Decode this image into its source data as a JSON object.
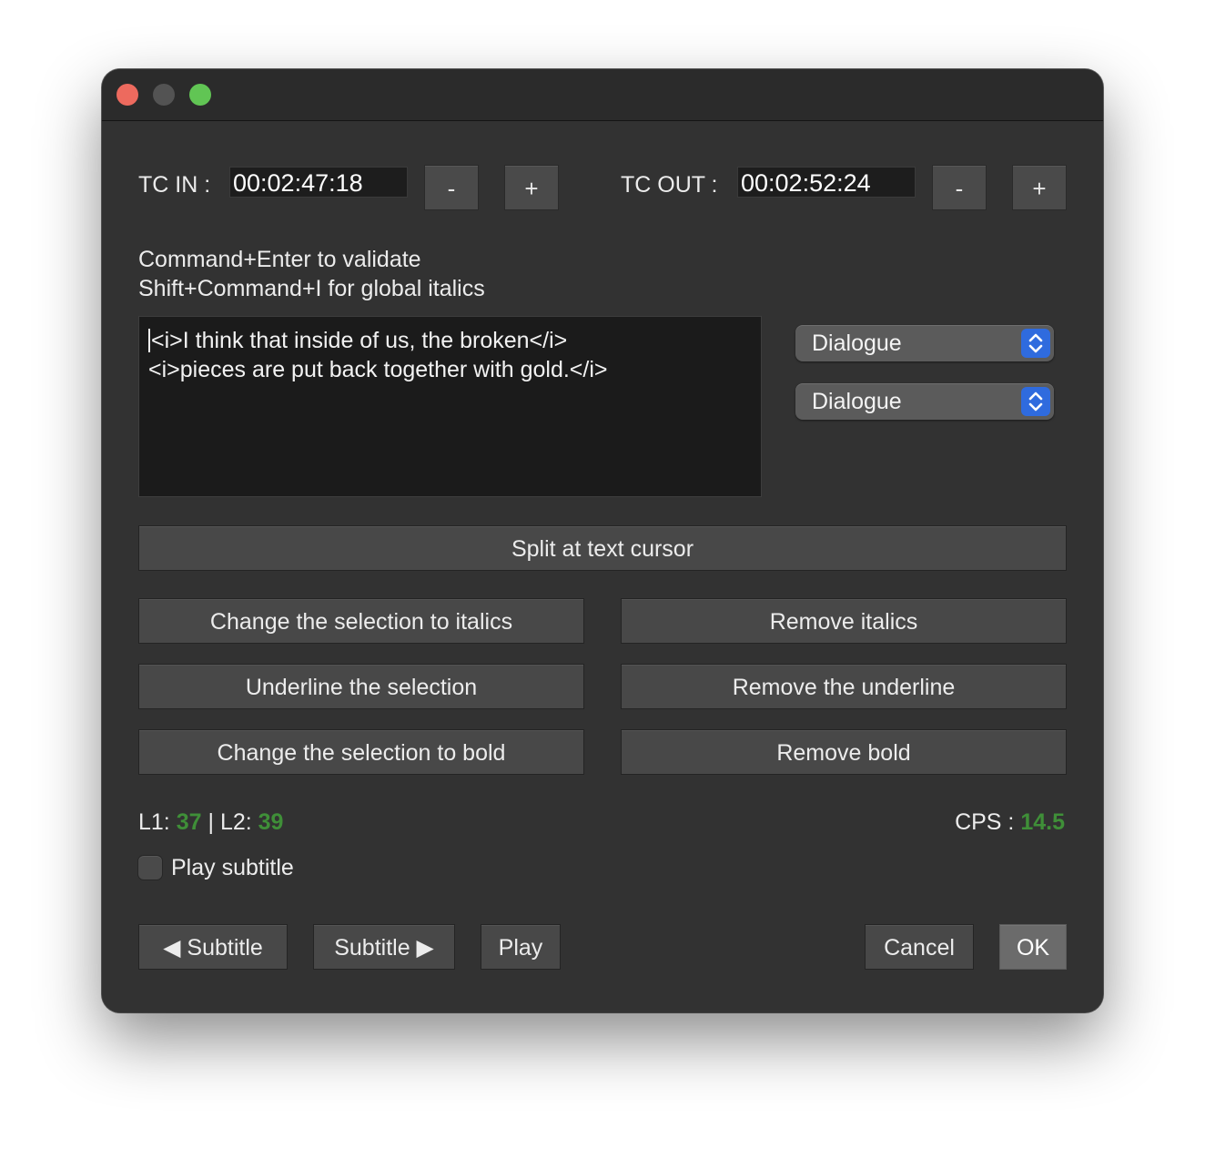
{
  "window": {
    "traffic_lights": {
      "close": "#ed6a5e",
      "minimize": "#535353",
      "zoom": "#61c554"
    }
  },
  "timecode": {
    "in_label": "TC IN :",
    "in_value": "00:02:47:18",
    "out_label": "TC OUT :",
    "out_value": "00:02:52:24",
    "minus_label": "-",
    "plus_label": "+"
  },
  "hints": {
    "line1": "Command+Enter to validate",
    "line2": "Shift+Command+I for global italics"
  },
  "editor": {
    "line1": "<i>I think that inside of us, the broken</i>",
    "line2": "<i>pieces are put back together with gold.</i>"
  },
  "styles": {
    "select1": "Dialogue",
    "select2": "Dialogue",
    "stepper_color": "#2f6bde"
  },
  "actions": {
    "split": "Split at text cursor",
    "italic": "Change the selection to italics",
    "remove_italics": "Remove italics",
    "underline": "Underline the selection",
    "remove_underline": "Remove the underline",
    "bold": "Change the selection to bold",
    "remove_bold": "Remove bold"
  },
  "stats": {
    "l1_label": "L1:",
    "l1_value": "37",
    "separator": "|",
    "l2_label": "L2:",
    "l2_value": "39",
    "cps_label": "CPS :",
    "cps_value": "14.5",
    "value_color": "#3f8f38"
  },
  "playback": {
    "play_subtitle_label": "Play subtitle",
    "play_subtitle_checked": false,
    "prev_label": "◀ Subtitle",
    "next_label": "Subtitle ▶",
    "play_label": "Play",
    "cancel_label": "Cancel",
    "ok_label": "OK"
  }
}
